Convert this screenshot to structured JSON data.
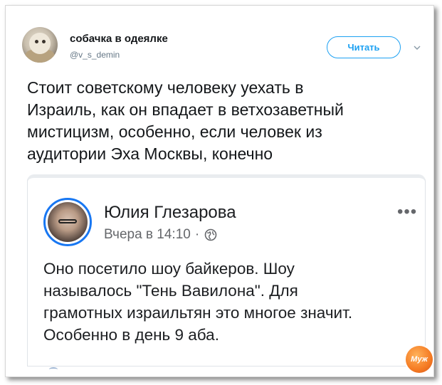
{
  "tweet": {
    "author_name": "собачка в одеялке",
    "author_handle": "@v_s_demin",
    "follow_label": "Читать",
    "text_lines": [
      "Стоит советскому человеку уехать в",
      "Израиль, как он впадает в ветхозаветный",
      "мистицизм, особенно, если человек из",
      "аудитории Эха Москвы, конечно"
    ]
  },
  "embed": {
    "author_name": "Юлия Глезарова",
    "timestamp": "Вчера в 14:10",
    "separator": "·",
    "more_label": "•••",
    "text_lines": [
      "Оно посетило шоу байкеров. Шоу",
      "называлось \"Тень Вавилона\". Для",
      "грамотных израильтян это многое значит.",
      "Особенно в день 9 аба."
    ]
  },
  "watermark": {
    "label": "Муж"
  },
  "colors": {
    "accent": "#1da1f2",
    "fb_blue": "#1877f2",
    "watermark": "#f57b23"
  }
}
